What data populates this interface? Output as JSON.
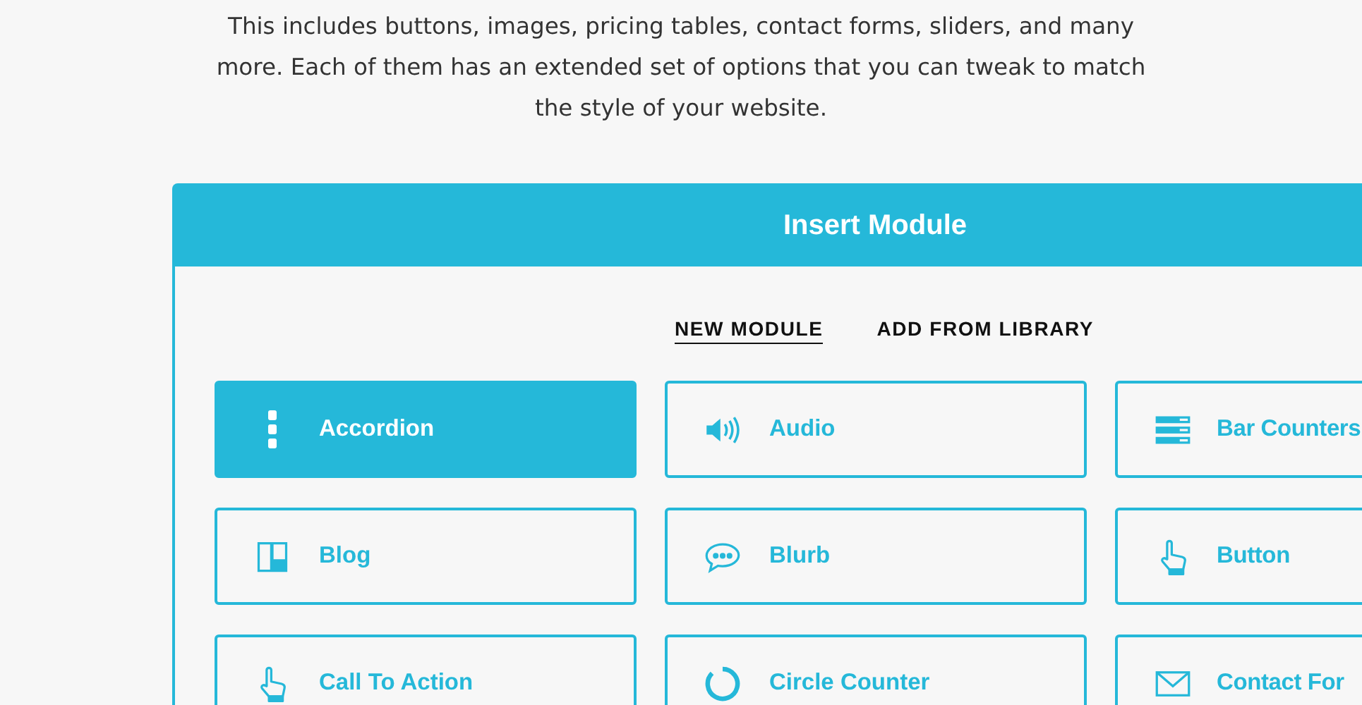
{
  "intro": "This includes buttons, images, pricing tables, contact forms, sliders, and many more. Each of them has an extended set of options that you can tweak to match the style of your website.",
  "panel": {
    "title": "Insert Module",
    "tabs": [
      {
        "label": "NEW MODULE",
        "selected": true
      },
      {
        "label": "ADD FROM LIBRARY",
        "selected": false
      }
    ],
    "modules": [
      {
        "label": "Accordion",
        "selected": true
      },
      {
        "label": "Audio",
        "selected": false
      },
      {
        "label": "Bar Counters",
        "selected": false
      },
      {
        "label": "Blog",
        "selected": false
      },
      {
        "label": "Blurb",
        "selected": false
      },
      {
        "label": "Button",
        "selected": false
      },
      {
        "label": "Call To Action",
        "selected": false
      },
      {
        "label": "Circle Counter",
        "selected": false
      },
      {
        "label": "Contact For",
        "selected": false
      }
    ]
  }
}
